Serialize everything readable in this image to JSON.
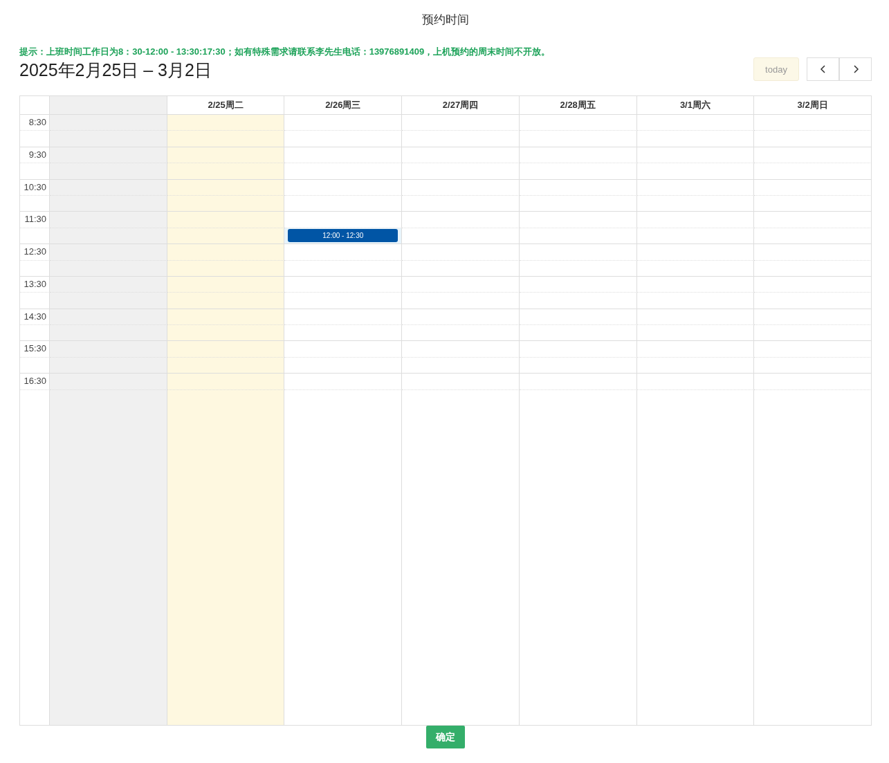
{
  "dialog": {
    "title": "预约时间"
  },
  "notice": "提示：上班时间工作日为8：30-12:00 - 13:30:17:30；如有特殊需求请联系李先生电话：13976891409，上机预约的周末时间不开放。",
  "range_title": "2025年2月25日 – 3月2日",
  "toolbar": {
    "today_button": {
      "label": "today",
      "disabled": true
    }
  },
  "time_slots": [
    "8:30",
    "9:30",
    "10:30",
    "11:30",
    "12:30",
    "13:30",
    "14:30",
    "15:30",
    "16:30"
  ],
  "days": [
    {
      "kind": "past"
    },
    {
      "kind": "today",
      "label": "2/25周二"
    },
    {
      "kind": "open",
      "label": "2/26周三",
      "events": [
        {
          "label": "12:00 - 12:30"
        }
      ]
    },
    {
      "kind": "open",
      "label": "2/27周四"
    },
    {
      "kind": "open",
      "label": "2/28周五"
    },
    {
      "kind": "open",
      "label": "3/1周六"
    },
    {
      "kind": "open",
      "label": "3/2周日"
    }
  ],
  "confirm_button": "确定"
}
